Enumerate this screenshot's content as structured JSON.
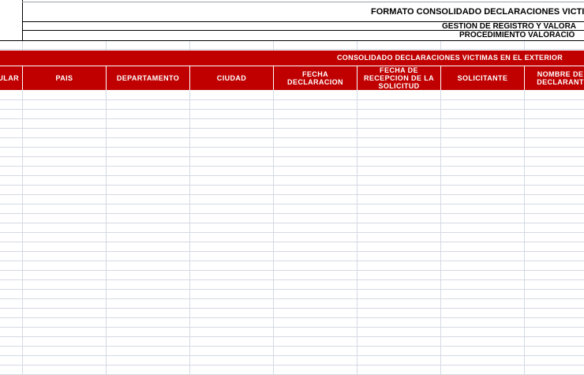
{
  "sheet": {
    "title_main": "FORMATO CONSOLIDADO DECLARACIONES VICTI",
    "title_sub1": "GESTIÓN DE REGISTRO Y VALORA",
    "title_sub2": "PROCEDIMIENTO VALORACIÓ",
    "band_title": "CONSOLIDADO DECLARACIONES VICTIMAS EN EL EXTERIOR",
    "columns": [
      "ULAR",
      "PAIS",
      "DEPARTAMENTO",
      "CIUDAD",
      "FECHA\nDECLARACION",
      "FECHA DE\nRECEPCION DE LA\nSOLICITUD",
      "SOLICITANTE",
      "NOMBRE DE\nDECLARANT"
    ]
  },
  "colors": {
    "header_red": "#c00000",
    "grid": "#d4d9e2",
    "header_text": "#ffffff"
  }
}
